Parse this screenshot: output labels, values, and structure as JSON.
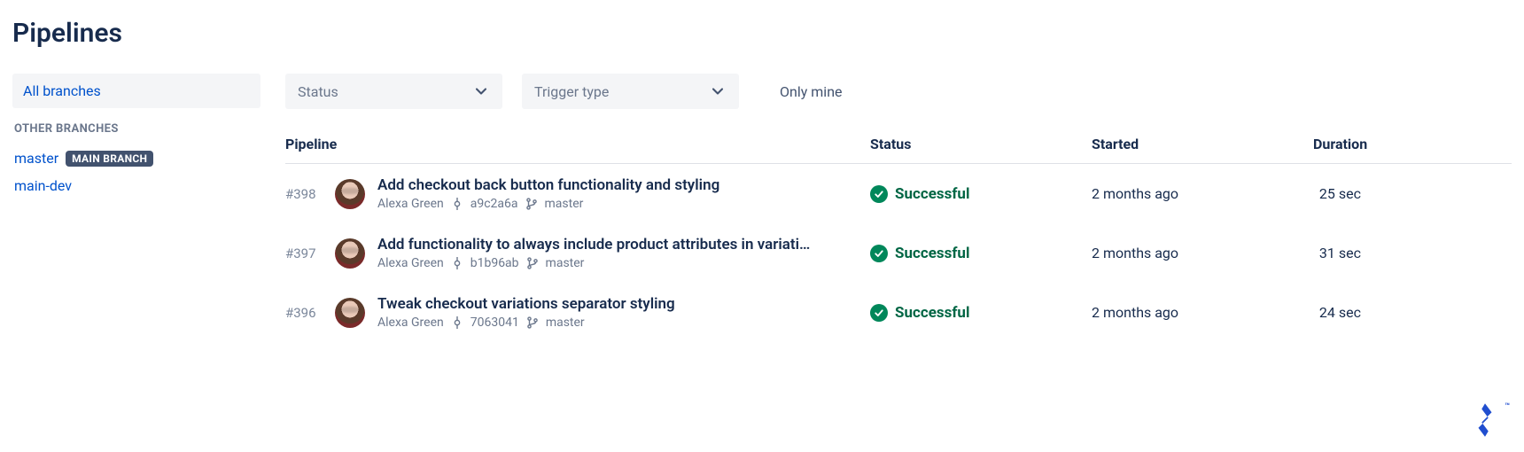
{
  "title": "Pipelines",
  "sidebar": {
    "selected_tab": "All branches",
    "section_label": "OTHER BRANCHES",
    "branches": [
      {
        "name": "master",
        "main_badge": "MAIN BRANCH"
      },
      {
        "name": "main-dev",
        "main_badge": null
      }
    ]
  },
  "filters": {
    "status_placeholder": "Status",
    "trigger_placeholder": "Trigger type",
    "only_mine": "Only mine"
  },
  "columns": {
    "pipeline": "Pipeline",
    "status": "Status",
    "started": "Started",
    "duration": "Duration"
  },
  "rows": [
    {
      "id": "#398",
      "title": "Add checkout back button functionality and styling",
      "author": "Alexa Green",
      "commit": "a9c2a6a",
      "branch": "master",
      "status": "Successful",
      "started": "2 months ago",
      "duration": "25 sec"
    },
    {
      "id": "#397",
      "title": "Add functionality to always include product attributes in variati…",
      "author": "Alexa Green",
      "commit": "b1b96ab",
      "branch": "master",
      "status": "Successful",
      "started": "2 months ago",
      "duration": "31 sec"
    },
    {
      "id": "#396",
      "title": "Tweak checkout variations separator styling",
      "author": "Alexa Green",
      "commit": "7063041",
      "branch": "master",
      "status": "Successful",
      "started": "2 months ago",
      "duration": "24 sec"
    }
  ],
  "logo_tm": "™"
}
